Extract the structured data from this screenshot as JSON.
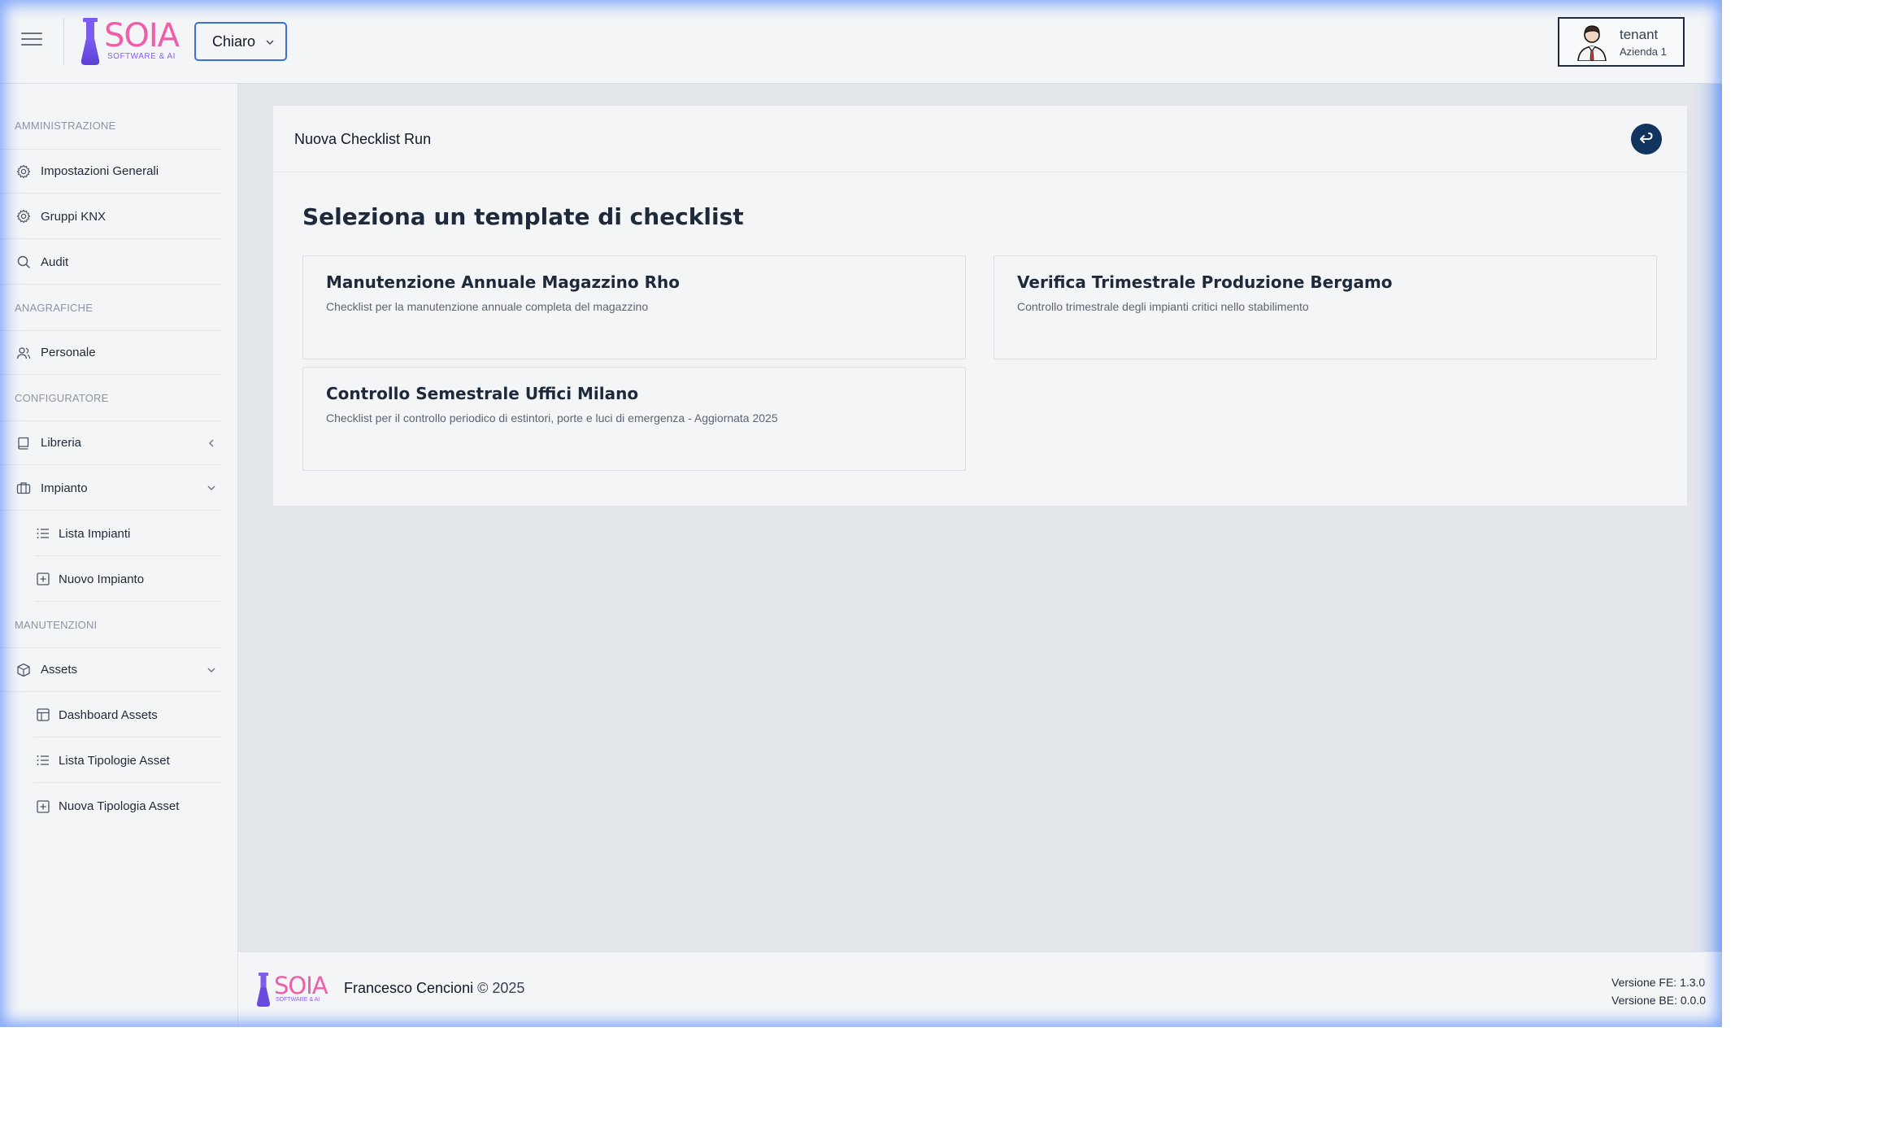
{
  "header": {
    "logo_text": "SOIA",
    "logo_subtitle": "SOFTWARE & AI",
    "theme_selected": "Chiaro",
    "user": {
      "name": "tenant",
      "company": "Azienda 1"
    }
  },
  "sidebar": {
    "sections": {
      "amministrazione": "AMMINISTRAZIONE",
      "anagrafiche": "ANAGRAFICHE",
      "configuratore": "CONFIGURATORE",
      "manutenzioni": "MANUTENZIONI"
    },
    "items": {
      "impostazioni_generali": {
        "label": "Impostazioni Generali",
        "icon": "gear-icon"
      },
      "gruppi_knx": {
        "label": "Gruppi KNX",
        "icon": "gear-icon"
      },
      "audit": {
        "label": "Audit",
        "icon": "search-icon"
      },
      "personale": {
        "label": "Personale",
        "icon": "users-icon"
      },
      "libreria": {
        "label": "Libreria",
        "icon": "book-icon",
        "expanded": false
      },
      "impianto": {
        "label": "Impianto",
        "icon": "briefcase-icon",
        "expanded": true
      },
      "lista_impianti": {
        "label": "Lista Impianti",
        "icon": "list-icon"
      },
      "nuovo_impianto": {
        "label": "Nuovo Impianto",
        "icon": "plus-square-icon"
      },
      "assets": {
        "label": "Assets",
        "icon": "box-icon",
        "expanded": true
      },
      "dashboard_assets": {
        "label": "Dashboard Assets",
        "icon": "layout-icon"
      },
      "lista_tipologie_asset": {
        "label": "Lista Tipologie Asset",
        "icon": "list-icon"
      },
      "nuova_tipologia_asset": {
        "label": "Nuova Tipologia Asset",
        "icon": "plus-square-icon"
      }
    }
  },
  "main": {
    "card_title": "Nuova Checklist Run",
    "heading": "Seleziona un template di checklist",
    "templates": [
      {
        "name": "Manutenzione Annuale Magazzino Rho",
        "description": "Checklist per la manutenzione annuale completa del magazzino"
      },
      {
        "name": "Verifica Trimestrale Produzione Bergamo",
        "description": "Controllo trimestrale degli impianti critici nello stabilimento"
      },
      {
        "name": "Controllo Semestrale Uffici Milano",
        "description": "Checklist per il controllo periodico di estintori, porte e luci di emergenza - Aggiornata 2025"
      }
    ]
  },
  "footer": {
    "logo_text": "SOIA",
    "logo_subtitle": "SOFTWARE & AI",
    "author": "Francesco Cencioni",
    "copyright": "© 2025",
    "version_fe": "Versione FE: 1.3.0",
    "version_be": "Versione BE: 0.0.0"
  },
  "colors": {
    "brand_pink": "#ef5ea8",
    "brand_purple": "#8b5cf6",
    "accent_blue": "#3b6fd8",
    "back_button": "#12355f"
  }
}
